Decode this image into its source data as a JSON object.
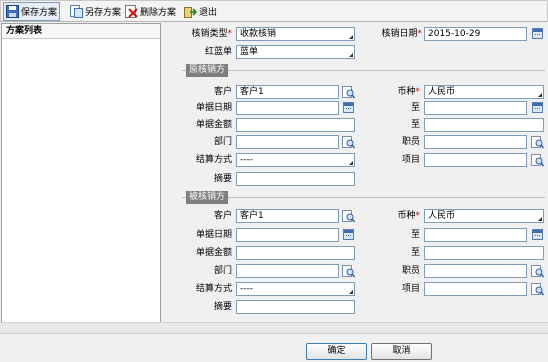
{
  "toolbar": {
    "save_label": "保存方案",
    "save_as_label": "另存方案",
    "delete_label": "删除方案",
    "exit_label": "退出"
  },
  "left_panel": {
    "title": "方案列表"
  },
  "header": {
    "type_label": "核销类型",
    "type_value": "收款核销",
    "date_label": "核销日期",
    "date_value": "2015-10-29",
    "red_blue_label": "红蓝单",
    "red_blue_value": "蓝单"
  },
  "original": {
    "title": "原核销方",
    "customer_label": "客户",
    "customer_value": "客户1",
    "currency_label": "币种",
    "currency_value": "人民币",
    "doc_date_label": "单据日期",
    "to_label": "至",
    "amount_label": "单据金额",
    "dept_label": "部门",
    "staff_label": "职员",
    "settle_label": "结算方式",
    "settle_value": "----",
    "project_label": "项目",
    "summary_label": "摘要"
  },
  "target": {
    "title": "被核销方",
    "customer_label": "客户",
    "customer_value": "客户1",
    "currency_label": "币种",
    "currency_value": "人民币",
    "doc_date_label": "单据日期",
    "to_label": "至",
    "amount_label": "单据金额",
    "dept_label": "部门",
    "staff_label": "职员",
    "settle_label": "结算方式",
    "settle_value": "----",
    "project_label": "项目",
    "summary_label": "摘要"
  },
  "footer": {
    "ok_label": "确定",
    "cancel_label": "取消"
  }
}
